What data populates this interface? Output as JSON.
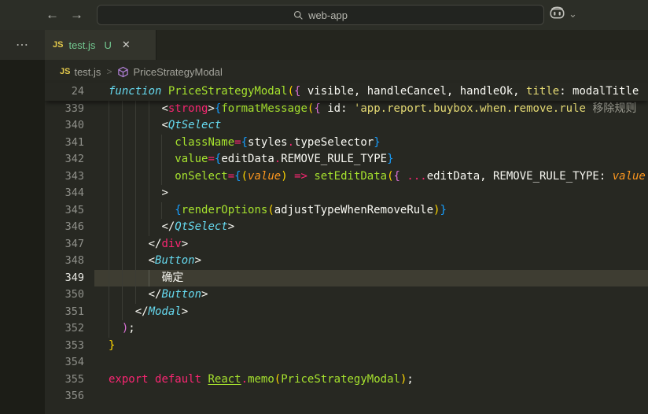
{
  "titlebar": {
    "back_icon": "←",
    "forward_icon": "→",
    "search_label": "web-app",
    "icons": {
      "search": "search-icon",
      "copilot": "copilot-icon",
      "chevron": "⌄"
    }
  },
  "tabbar": {
    "overflow_icon": "⋯",
    "tab": {
      "badge": "JS",
      "name": "test.js",
      "git_status": "U",
      "close_icon": "✕"
    }
  },
  "breadcrumb": {
    "badge": "JS",
    "file": "test.js",
    "separator": ">",
    "symbol_icon": "symbol-class-cube",
    "symbol": "PriceStrategyModal"
  },
  "editor": {
    "colors": {
      "background": "#272822",
      "current_line": "#3e3d32",
      "keyword": "#f92672",
      "function": "#a6e22e",
      "type": "#66d9ef",
      "string": "#e6db74",
      "parameter": "#fd971f",
      "bracket1": "#ffd700",
      "bracket2": "#da70d6",
      "bracket3": "#179fff"
    },
    "sticky_line": {
      "num": "24",
      "indent": 0,
      "tokens": [
        [
          "function ",
          "cy"
        ],
        [
          "PriceStrategyModal",
          "gn"
        ],
        [
          "(",
          "g1"
        ],
        [
          "{",
          "g2"
        ],
        [
          " visible, handleCancel, handleOk, ",
          "w"
        ],
        [
          "title",
          "yl"
        ],
        [
          ":",
          "w"
        ],
        [
          " modalTitle",
          "w"
        ]
      ]
    },
    "lines": [
      {
        "num": "339",
        "indent": 8,
        "tokens": [
          [
            "<",
            "w"
          ],
          [
            "strong",
            "pk"
          ],
          [
            ">",
            "w"
          ],
          [
            "{",
            "g3"
          ],
          [
            "formatMessage",
            "gn"
          ],
          [
            "(",
            "g1"
          ],
          [
            "{",
            "g2"
          ],
          [
            " id: ",
            "w"
          ],
          [
            "'app.report.buybox.when.remove.rule",
            "yl"
          ],
          [
            " 移除规则",
            "gy"
          ]
        ]
      },
      {
        "num": "340",
        "indent": 8,
        "tokens": [
          [
            "<",
            "w"
          ],
          [
            "QtSelect",
            "cy"
          ]
        ]
      },
      {
        "num": "341",
        "indent": 10,
        "tokens": [
          [
            "className",
            "gn"
          ],
          [
            "=",
            "pk"
          ],
          [
            "{",
            "g3"
          ],
          [
            "styles",
            "w"
          ],
          [
            ".",
            "pk"
          ],
          [
            "typeSelector",
            "w"
          ],
          [
            "}",
            "g3"
          ]
        ]
      },
      {
        "num": "342",
        "indent": 10,
        "tokens": [
          [
            "value",
            "gn"
          ],
          [
            "=",
            "pk"
          ],
          [
            "{",
            "g3"
          ],
          [
            "editData",
            "w"
          ],
          [
            ".",
            "pk"
          ],
          [
            "REMOVE_RULE_TYPE",
            "w"
          ],
          [
            "}",
            "g3"
          ]
        ]
      },
      {
        "num": "343",
        "indent": 10,
        "tokens": [
          [
            "onSelect",
            "gn"
          ],
          [
            "=",
            "pk"
          ],
          [
            "{",
            "g3"
          ],
          [
            "(",
            "g1"
          ],
          [
            "value",
            "or"
          ],
          [
            ")",
            "g1"
          ],
          [
            " ",
            "w"
          ],
          [
            "=>",
            "pk"
          ],
          [
            " ",
            "w"
          ],
          [
            "setEditData",
            "gn"
          ],
          [
            "(",
            "g1"
          ],
          [
            "{",
            "g2"
          ],
          [
            " ",
            "w"
          ],
          [
            "...",
            "pk"
          ],
          [
            "editData",
            "w"
          ],
          [
            ", REMOVE_RULE_TYPE: ",
            "w"
          ],
          [
            "value",
            "or"
          ]
        ]
      },
      {
        "num": "344",
        "indent": 8,
        "tokens": [
          [
            ">",
            "w"
          ]
        ]
      },
      {
        "num": "345",
        "indent": 10,
        "tokens": [
          [
            "{",
            "g3"
          ],
          [
            "renderOptions",
            "gn"
          ],
          [
            "(",
            "g1"
          ],
          [
            "adjustTypeWhenRemoveRule",
            "w"
          ],
          [
            ")",
            "g1"
          ],
          [
            "}",
            "g3"
          ]
        ]
      },
      {
        "num": "346",
        "indent": 8,
        "tokens": [
          [
            "</",
            "w"
          ],
          [
            "QtSelect",
            "cy"
          ],
          [
            ">",
            "w"
          ]
        ]
      },
      {
        "num": "347",
        "indent": 6,
        "tokens": [
          [
            "</",
            "w"
          ],
          [
            "div",
            "pk"
          ],
          [
            ">",
            "w"
          ]
        ]
      },
      {
        "num": "348",
        "indent": 6,
        "tokens": [
          [
            "<",
            "w"
          ],
          [
            "Button",
            "cy"
          ],
          [
            ">",
            "w"
          ]
        ]
      },
      {
        "num": "349",
        "indent": 8,
        "current": true,
        "active_guide": 6,
        "tokens": [
          [
            "确定",
            "w"
          ]
        ]
      },
      {
        "num": "350",
        "indent": 6,
        "tokens": [
          [
            "</",
            "w"
          ],
          [
            "Button",
            "cy"
          ],
          [
            ">",
            "w"
          ]
        ]
      },
      {
        "num": "351",
        "indent": 4,
        "tokens": [
          [
            "</",
            "w"
          ],
          [
            "Modal",
            "cy"
          ],
          [
            ">",
            "w"
          ]
        ]
      },
      {
        "num": "352",
        "indent": 2,
        "tokens": [
          [
            ")",
            "g2"
          ],
          [
            ";",
            "w"
          ]
        ]
      },
      {
        "num": "353",
        "indent": 0,
        "tokens": [
          [
            "}",
            "g1"
          ]
        ]
      },
      {
        "num": "354",
        "indent": 0,
        "tokens": []
      },
      {
        "num": "355",
        "indent": 0,
        "tokens": [
          [
            "export",
            "pk"
          ],
          [
            " ",
            "w"
          ],
          [
            "default",
            "pk"
          ],
          [
            " ",
            "w"
          ],
          [
            "React",
            "gnu"
          ],
          [
            ".",
            "pk"
          ],
          [
            "memo",
            "gn"
          ],
          [
            "(",
            "g1"
          ],
          [
            "PriceStrategyModal",
            "gn"
          ],
          [
            ")",
            "g1"
          ],
          [
            ";",
            "w"
          ]
        ]
      },
      {
        "num": "356",
        "indent": 0,
        "tokens": []
      }
    ]
  }
}
